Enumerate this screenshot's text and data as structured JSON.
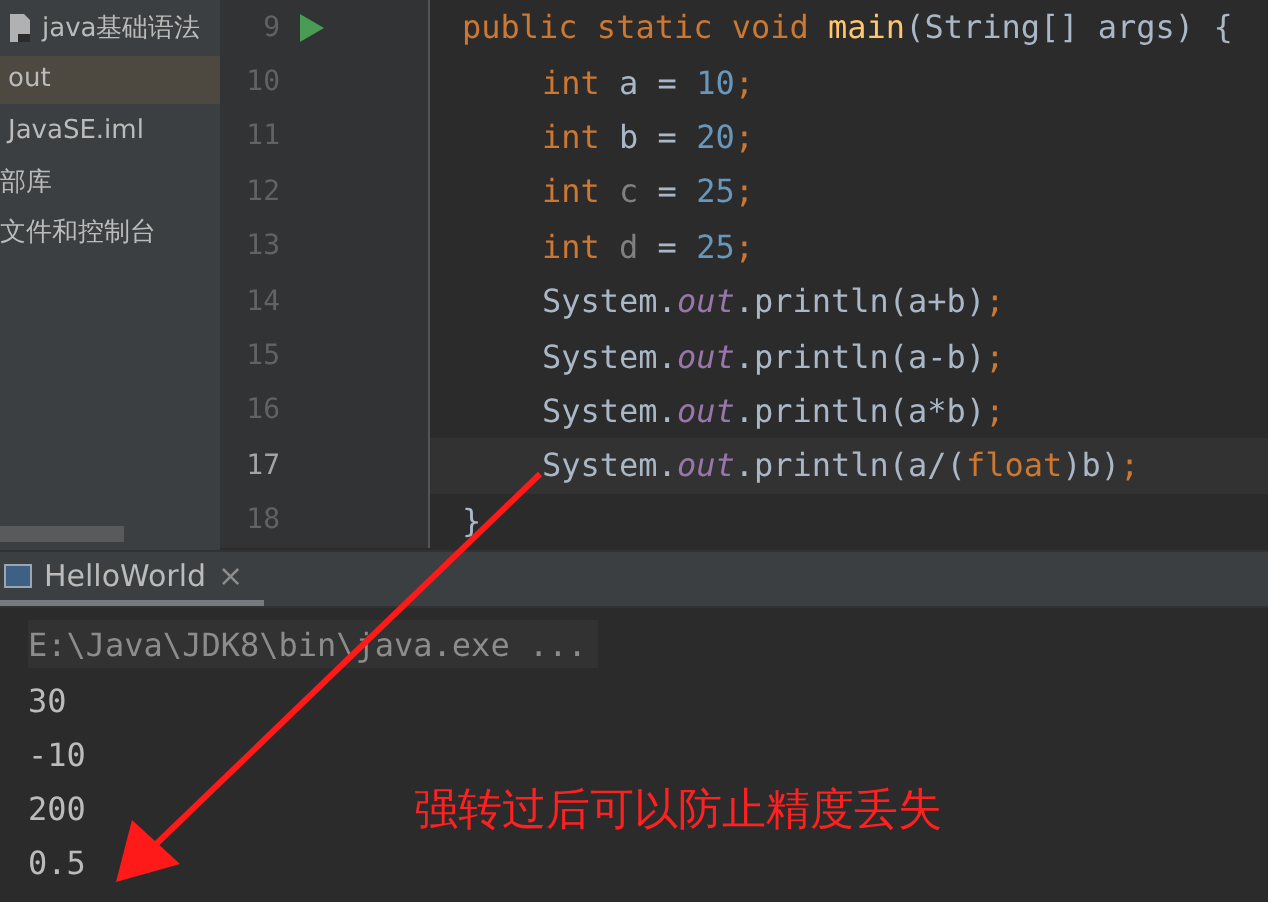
{
  "project": {
    "items": [
      {
        "label": "java基础语法",
        "kind": "module",
        "selected": false
      },
      {
        "label": "out",
        "kind": "folder",
        "selected": true
      },
      {
        "label": "JavaSE.iml",
        "kind": "file",
        "selected": false
      },
      {
        "label": "部库",
        "kind": "text",
        "selected": false
      },
      {
        "label": "文件和控制台",
        "kind": "text",
        "selected": false
      }
    ]
  },
  "editor": {
    "lines": [
      {
        "number": "9",
        "current": false,
        "run": true,
        "tokens": [
          {
            "kind": "keyword",
            "text": "public static void "
          },
          {
            "kind": "method",
            "text": "main"
          },
          {
            "kind": "plain",
            "text": "(String[] args) {"
          }
        ],
        "children": [
          {
            "number": "10",
            "current": false,
            "run": false,
            "tokens": [
              {
                "kind": "keyword",
                "text": "int "
              },
              {
                "kind": "plain",
                "text": "a = "
              },
              {
                "kind": "number",
                "text": "10"
              },
              {
                "kind": "keyword",
                "text": ";"
              }
            ]
          },
          {
            "number": "11",
            "current": false,
            "run": false,
            "tokens": [
              {
                "kind": "keyword",
                "text": "int "
              },
              {
                "kind": "plain",
                "text": "b = "
              },
              {
                "kind": "number",
                "text": "20"
              },
              {
                "kind": "keyword",
                "text": ";"
              }
            ]
          },
          {
            "number": "12",
            "current": false,
            "run": false,
            "tokens": [
              {
                "kind": "keyword",
                "text": "int "
              },
              {
                "kind": "unused",
                "text": "c"
              },
              {
                "kind": "plain",
                "text": " = "
              },
              {
                "kind": "number",
                "text": "25"
              },
              {
                "kind": "keyword",
                "text": ";"
              }
            ]
          },
          {
            "number": "13",
            "current": false,
            "run": false,
            "tokens": [
              {
                "kind": "keyword",
                "text": "int "
              },
              {
                "kind": "unused",
                "text": "d"
              },
              {
                "kind": "plain",
                "text": " = "
              },
              {
                "kind": "number",
                "text": "25"
              },
              {
                "kind": "keyword",
                "text": ";"
              }
            ]
          },
          {
            "number": "14",
            "current": false,
            "run": false,
            "tokens": [
              {
                "kind": "plain",
                "text": "System."
              },
              {
                "kind": "field",
                "text": "out"
              },
              {
                "kind": "plain",
                "text": ".println(a+b)"
              },
              {
                "kind": "keyword",
                "text": ";"
              }
            ]
          },
          {
            "number": "15",
            "current": false,
            "run": false,
            "tokens": [
              {
                "kind": "plain",
                "text": "System."
              },
              {
                "kind": "field",
                "text": "out"
              },
              {
                "kind": "plain",
                "text": ".println(a-b)"
              },
              {
                "kind": "keyword",
                "text": ";"
              }
            ]
          },
          {
            "number": "16",
            "current": false,
            "run": false,
            "tokens": [
              {
                "kind": "plain",
                "text": "System."
              },
              {
                "kind": "field",
                "text": "out"
              },
              {
                "kind": "plain",
                "text": ".println(a*b)"
              },
              {
                "kind": "keyword",
                "text": ";"
              }
            ]
          },
          {
            "number": "17",
            "current": true,
            "run": false,
            "tokens": [
              {
                "kind": "plain",
                "text": "System."
              },
              {
                "kind": "field",
                "text": "out"
              },
              {
                "kind": "plain",
                "text": ".println(a/("
              },
              {
                "kind": "keyword",
                "text": "float"
              },
              {
                "kind": "plain",
                "text": ")b)"
              },
              {
                "kind": "keyword",
                "text": ";"
              }
            ]
          }
        ]
      },
      {
        "number": "18",
        "current": false,
        "run": false,
        "tokens": [
          {
            "kind": "plain",
            "text": "}"
          }
        ]
      }
    ]
  },
  "run_panel": {
    "tabs": [
      {
        "label": "HelloWorld",
        "close": "×",
        "selected": true
      }
    ],
    "command": "E:\\Java\\JDK8\\bin\\java.exe ...",
    "output": [
      "30",
      "-10",
      "200",
      "0.5"
    ]
  },
  "annotation": {
    "text": "强转过后可以防止精度丢失"
  }
}
